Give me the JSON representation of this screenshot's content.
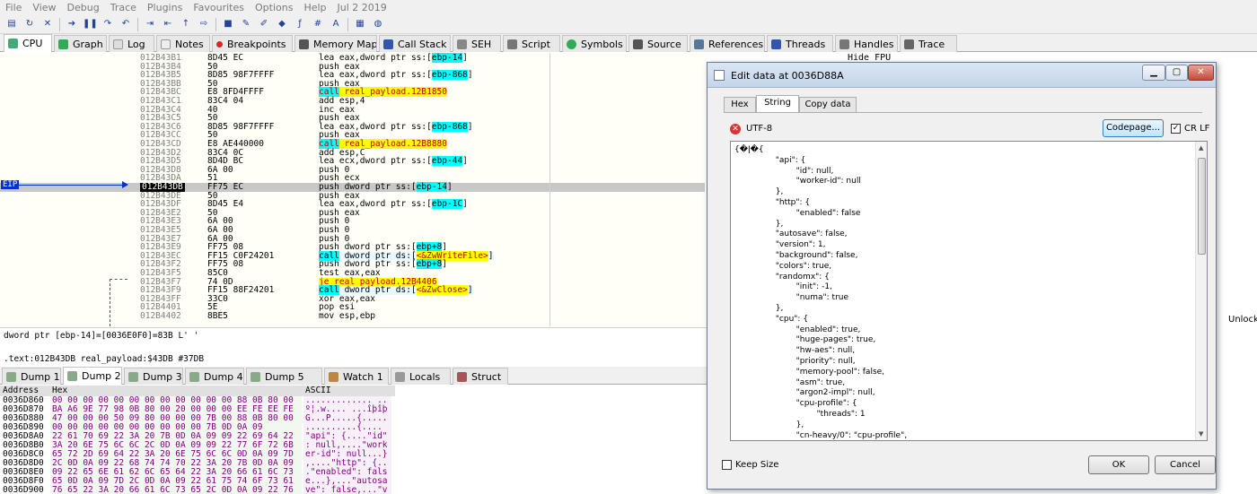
{
  "menu": [
    "File",
    "View",
    "Debug",
    "Trace",
    "Plugins",
    "Favourites",
    "Options",
    "Help",
    "Jul 2 2019"
  ],
  "tabs": [
    "CPU",
    "Graph",
    "Log",
    "Notes",
    "Breakpoints",
    "Memory Map",
    "Call Stack",
    "SEH",
    "Script",
    "Symbols",
    "Source",
    "References",
    "Threads",
    "Handles",
    "Trace"
  ],
  "disasm": [
    {
      "addr": "012B43B1",
      "bytes": "8D45 EC",
      "ins": "lea eax,dword ptr ss:[ebp-14]",
      "hl": ""
    },
    {
      "addr": "012B43B4",
      "bytes": "50",
      "ins": "push eax",
      "hl": ""
    },
    {
      "addr": "012B43B5",
      "bytes": "8D85 98F7FFFF",
      "ins": "lea eax,dword ptr ss:[ebp-868]",
      "hl": ""
    },
    {
      "addr": "012B43BB",
      "bytes": "50",
      "ins": "push eax",
      "hl": ""
    },
    {
      "addr": "012B43BC",
      "bytes": "E8 8FD4FFFF",
      "ins": "call real_payload.12B1850",
      "hl": "call"
    },
    {
      "addr": "012B43C1",
      "bytes": "83C4 04",
      "ins": "add esp,4",
      "hl": ""
    },
    {
      "addr": "012B43C4",
      "bytes": "40",
      "ins": "inc eax",
      "hl": ""
    },
    {
      "addr": "012B43C5",
      "bytes": "50",
      "ins": "push eax",
      "hl": ""
    },
    {
      "addr": "012B43C6",
      "bytes": "8D85 98F7FFFF",
      "ins": "lea eax,dword ptr ss:[ebp-868]",
      "hl": ""
    },
    {
      "addr": "012B43CC",
      "bytes": "50",
      "ins": "push eax",
      "hl": ""
    },
    {
      "addr": "012B43CD",
      "bytes": "E8 AE440000",
      "ins": "call real_payload.12B8880",
      "hl": "call"
    },
    {
      "addr": "012B43D2",
      "bytes": "83C4 0C",
      "ins": "add esp,C",
      "hl": ""
    },
    {
      "addr": "012B43D5",
      "bytes": "8D4D BC",
      "ins": "lea ecx,dword ptr ss:[ebp-44]",
      "hl": ""
    },
    {
      "addr": "012B43D8",
      "bytes": "6A 00",
      "ins": "push 0",
      "hl": ""
    },
    {
      "addr": "012B43DA",
      "bytes": "51",
      "ins": "push ecx",
      "hl": ""
    },
    {
      "addr": "012B43DB",
      "bytes": "FF75 EC",
      "ins": "push dword ptr ss:[ebp-14]",
      "hl": "eip"
    },
    {
      "addr": "012B43DE",
      "bytes": "50",
      "ins": "push eax",
      "hl": ""
    },
    {
      "addr": "012B43DF",
      "bytes": "8D45 E4",
      "ins": "lea eax,dword ptr ss:[ebp-1C]",
      "hl": ""
    },
    {
      "addr": "012B43E2",
      "bytes": "50",
      "ins": "push eax",
      "hl": ""
    },
    {
      "addr": "012B43E3",
      "bytes": "6A 00",
      "ins": "push 0",
      "hl": ""
    },
    {
      "addr": "012B43E5",
      "bytes": "6A 00",
      "ins": "push 0",
      "hl": ""
    },
    {
      "addr": "012B43E7",
      "bytes": "6A 00",
      "ins": "push 0",
      "hl": ""
    },
    {
      "addr": "012B43E9",
      "bytes": "FF75 08",
      "ins": "push dword ptr ss:[ebp+8]",
      "hl": ""
    },
    {
      "addr": "012B43EC",
      "bytes": "FF15 C0F24201",
      "ins": "call dword ptr ds:[<&ZwWriteFile>]",
      "hl": "callds"
    },
    {
      "addr": "012B43F2",
      "bytes": "FF75 08",
      "ins": "push dword ptr ss:[ebp+8]",
      "hl": ""
    },
    {
      "addr": "012B43F5",
      "bytes": "85C0",
      "ins": "test eax,eax",
      "hl": ""
    },
    {
      "addr": "012B43F7",
      "bytes": "74 0D",
      "ins": "je real_payload.12B4406",
      "hl": "je"
    },
    {
      "addr": "012B43F9",
      "bytes": "FF15 88F24201",
      "ins": "call dword ptr ds:[<&ZwClose>]",
      "hl": "callds"
    },
    {
      "addr": "012B43FF",
      "bytes": "33C0",
      "ins": "xor eax,eax",
      "hl": ""
    },
    {
      "addr": "012B4401",
      "bytes": "5E",
      "ins": "pop esi",
      "hl": ""
    },
    {
      "addr": "012B4402",
      "bytes": "8BE5",
      "ins": "mov esp,ebp",
      "hl": ""
    }
  ],
  "eip_label": "EIP",
  "right_pane": {
    "hide_fpu": "Hide FPU",
    "unlock": "Unlock"
  },
  "info": {
    "line1": "dword ptr [ebp-14]=[0036E0F0]=83B L'  '",
    "line2": ".text:012B43DB real_payload:$43DB #37DB"
  },
  "dump_tabs": [
    "Dump 1",
    "Dump 2",
    "Dump 3",
    "Dump 4",
    "Dump 5",
    "Watch 1",
    "Locals",
    "Struct"
  ],
  "dump_header": {
    "address": "Address",
    "hex": "Hex",
    "ascii": "ASCII"
  },
  "dump_rows": [
    {
      "a": "0036D860",
      "h": "00 00 00 00 00 00 00 00 00 00 00 00 88 0B 80 00",
      "s": "............. .."
    },
    {
      "a": "0036D870",
      "h": "BA A6 9E 77 98 0B 80 00 20 00 00 00 EE FE EE FE",
      "s": "º¦.w.... ...îþîþ"
    },
    {
      "a": "0036D880",
      "h": "47 00 00 00 50 09 80 00 00 00 7B 00 88 0B 80 00",
      "s": "G...P.....{....."
    },
    {
      "a": "0036D890",
      "h": "00 00 00 00 00 00 00 00 00 00 7B 0D 0A 09",
      "s": "..........{...."
    },
    {
      "a": "0036D8A0",
      "h": "22 61 70 69 22 3A 20 7B 0D 0A 09 09 22 69 64 22",
      "s": "\"api\": {....\"id\""
    },
    {
      "a": "0036D8B0",
      "h": "3A 20 6E 75 6C 6C 2C 0D 0A 09 09 22 77 6F 72 6B",
      "s": ": null,....\"work"
    },
    {
      "a": "0036D8C0",
      "h": "65 72 2D 69 64 22 3A 20 6E 75 6C 6C 0D 0A 09 7D",
      "s": "er-id\": null...}"
    },
    {
      "a": "0036D8D0",
      "h": "2C 0D 0A 09 22 68 74 74 70 22 3A 20 7B 0D 0A 09",
      "s": ",....\"http\": {.."
    },
    {
      "a": "0036D8E0",
      "h": "09 22 65 6E 61 62 6C 65 64 22 3A 20 66 61 6C 73",
      "s": ".\"enabled\": fals"
    },
    {
      "a": "0036D8F0",
      "h": "65 0D 0A 09 7D 2C 0D 0A 09 22 61 75 74 6F 73 61",
      "s": "e...},...\"autosa"
    },
    {
      "a": "0036D900",
      "h": "76 65 22 3A 20 66 61 6C 73 65 2C 0D 0A 09 22 76",
      "s": "ve\": false,...\"v"
    }
  ],
  "dialog": {
    "title": "Edit data at 0036D88A",
    "tabs": [
      "Hex",
      "String",
      "Copy data"
    ],
    "encoding": "UTF-8",
    "codepage_button": "Codepage...",
    "crlf_label": "CR LF",
    "crlf_checked": true,
    "content": "{�ǀ�{\n\t\t\"api\": {\n\t\t\t\"id\": null,\n\t\t\t\"worker-id\": null\n\t\t},\n\t\t\"http\": {\n\t\t\t\"enabled\": false\n\t\t},\n\t\t\"autosave\": false,\n\t\t\"version\": 1,\n\t\t\"background\": false,\n\t\t\"colors\": true,\n\t\t\"randomx\": {\n\t\t\t\"init\": -1,\n\t\t\t\"numa\": true\n\t\t},\n\t\t\"cpu\": {\n\t\t\t\"enabled\": true,\n\t\t\t\"huge-pages\": true,\n\t\t\t\"hw-aes\": null,\n\t\t\t\"priority\": null,\n\t\t\t\"memory-pool\": false,\n\t\t\t\"asm\": true,\n\t\t\t\"argon2-impl\": null,\n\t\t\t\"cpu-profile\": {\n\t\t\t\t\"threads\": 1\n\t\t\t},\n\t\t\t\"cn-heavy/0\": \"cpu-profile\",",
    "keep_size_label": "Keep Size",
    "ok_button": "OK",
    "cancel_button": "Cancel"
  },
  "colors": {
    "call_bg": "#00ffff",
    "label_bg": "#ffff00",
    "eip_label_bg": "#0033cc"
  }
}
